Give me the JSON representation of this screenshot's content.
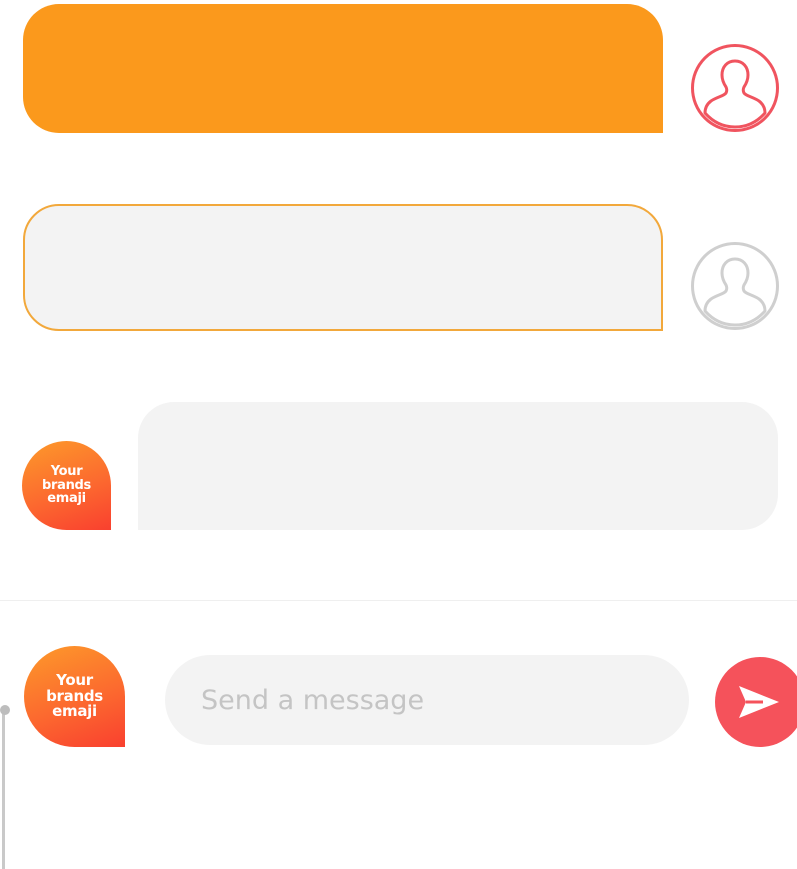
{
  "messages": [
    {
      "id": "outgoing-filled",
      "sender": "user",
      "text": ""
    },
    {
      "id": "outgoing-outlined",
      "sender": "user",
      "text": ""
    },
    {
      "id": "incoming",
      "sender": "brand",
      "text": ""
    }
  ],
  "brand": {
    "avatar_text": "Your\nbrands\nemaji"
  },
  "composer": {
    "placeholder": "Send a message",
    "value": ""
  },
  "icons": {
    "user_avatar": "user-silhouette-icon",
    "send": "send-arrow-icon"
  },
  "colors": {
    "accent_orange": "#fb991c",
    "outline_orange": "#f2a83b",
    "bubble_grey": "#f3f3f3",
    "avatar_active": "#f0545f",
    "avatar_inactive": "#cfcfcf",
    "send_red": "#f5525b"
  }
}
